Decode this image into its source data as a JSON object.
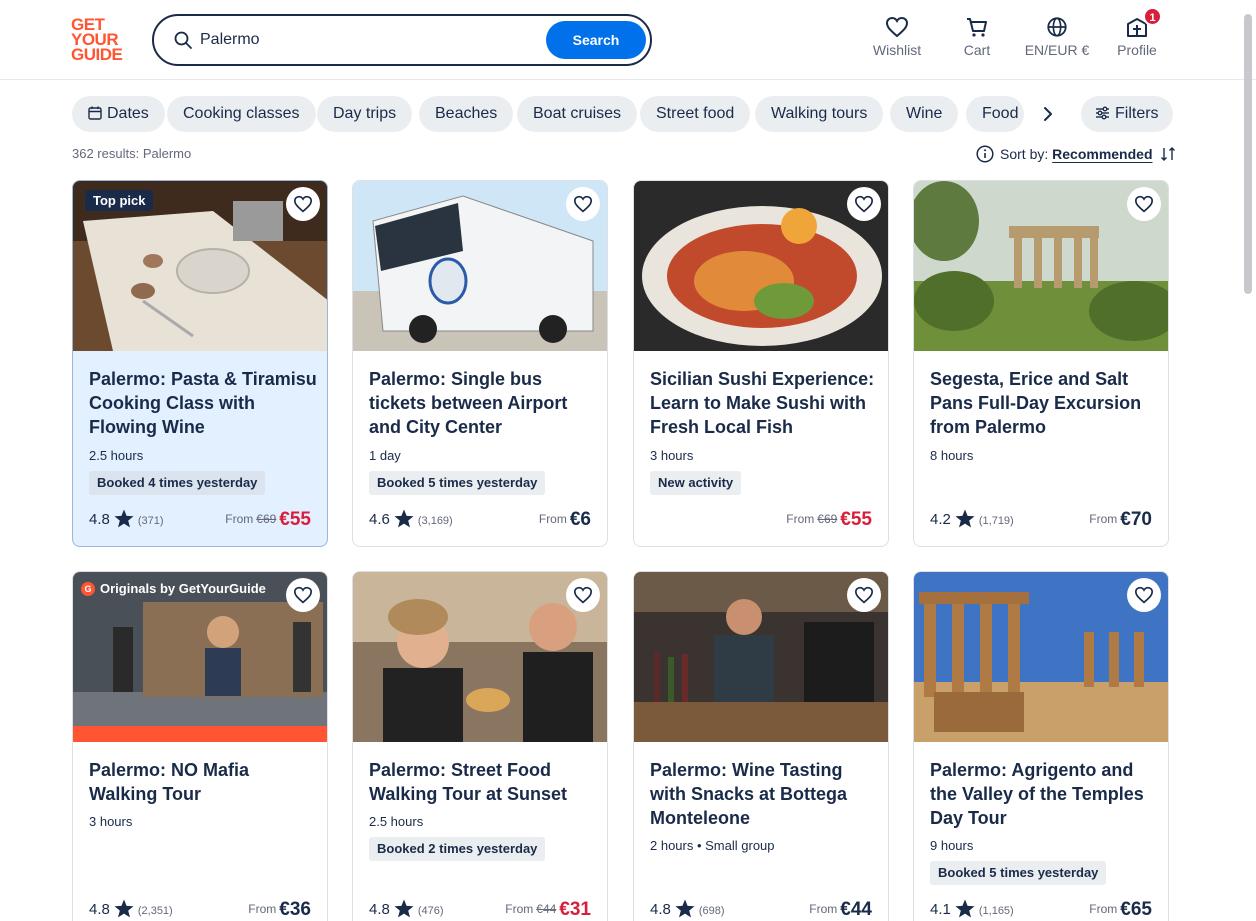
{
  "header": {
    "logo_lines": [
      "GET",
      "YOUR",
      "GUIDE"
    ],
    "search_value": "Palermo",
    "search_button": "Search",
    "nav": [
      {
        "label": "Wishlist",
        "icon": "heart-icon"
      },
      {
        "label": "Cart",
        "icon": "cart-icon"
      },
      {
        "label": "EN/EUR €",
        "icon": "globe-icon"
      },
      {
        "label": "Profile",
        "icon": "profile-icon",
        "badge": "1"
      }
    ]
  },
  "chips": [
    "Dates",
    "Cooking classes",
    "Day trips",
    "Beaches",
    "Boat cruises",
    "Street food",
    "Walking tours",
    "Wine",
    "Food"
  ],
  "filters_label": "Filters",
  "results_text": "362 results: Palermo",
  "sort": {
    "label": "Sort by:",
    "value": "Recommended"
  },
  "colors": {
    "brand": "#ff5533",
    "accent": "#0071eb",
    "sale": "#d81e3a",
    "text": "#1a2b49"
  },
  "cards": [
    {
      "title": "Palermo: Pasta & Tiramisu Cooking Class with Flowing Wine",
      "tag": "Top pick",
      "duration": "2.5 hours",
      "booked": "Booked 4 times yesterday",
      "rating": "4.8",
      "reviews": "(371)",
      "from": "From",
      "old_price": "€69",
      "price": "€55"
    },
    {
      "title": "Palermo: Single bus tickets between Airport and City Center",
      "duration": "1 day",
      "booked": "Booked 5 times yesterday",
      "rating": "4.6",
      "reviews": "(3,169)",
      "from": "From",
      "price": "€6"
    },
    {
      "title": "Sicilian Sushi Experience: Learn to Make Sushi with Fresh Local Fish",
      "duration": "3 hours",
      "booked": "New activity",
      "from": "From",
      "old_price": "€69",
      "price": "€55"
    },
    {
      "title": "Segesta, Erice and Salt Pans Full-Day Excursion from Palermo",
      "duration": "8 hours",
      "rating": "4.2",
      "reviews": "(1,719)",
      "from": "From",
      "price": "€70"
    },
    {
      "title": "Palermo: NO Mafia Walking Tour",
      "tag": "Originals by GetYourGuide",
      "duration": "3 hours",
      "rating": "4.8",
      "reviews": "(2,351)",
      "from": "From",
      "price": "€36"
    },
    {
      "title": "Palermo: Street Food Walking Tour at Sunset",
      "duration": "2.5 hours",
      "booked": "Booked 2 times yesterday",
      "rating": "4.8",
      "reviews": "(476)",
      "from": "From",
      "old_price": "€44",
      "price": "€31"
    },
    {
      "title": "Palermo: Wine Tasting with Snacks at Bottega Monteleone",
      "duration": "2 hours • Small group",
      "rating": "4.8",
      "reviews": "(698)",
      "from": "From",
      "price": "€44"
    },
    {
      "title": "Palermo: Agrigento and the Valley of the Temples Day Tour",
      "duration": "9 hours",
      "booked": "Booked 5 times yesterday",
      "rating": "4.1",
      "reviews": "(1,165)",
      "from": "From",
      "price": "€65"
    }
  ]
}
